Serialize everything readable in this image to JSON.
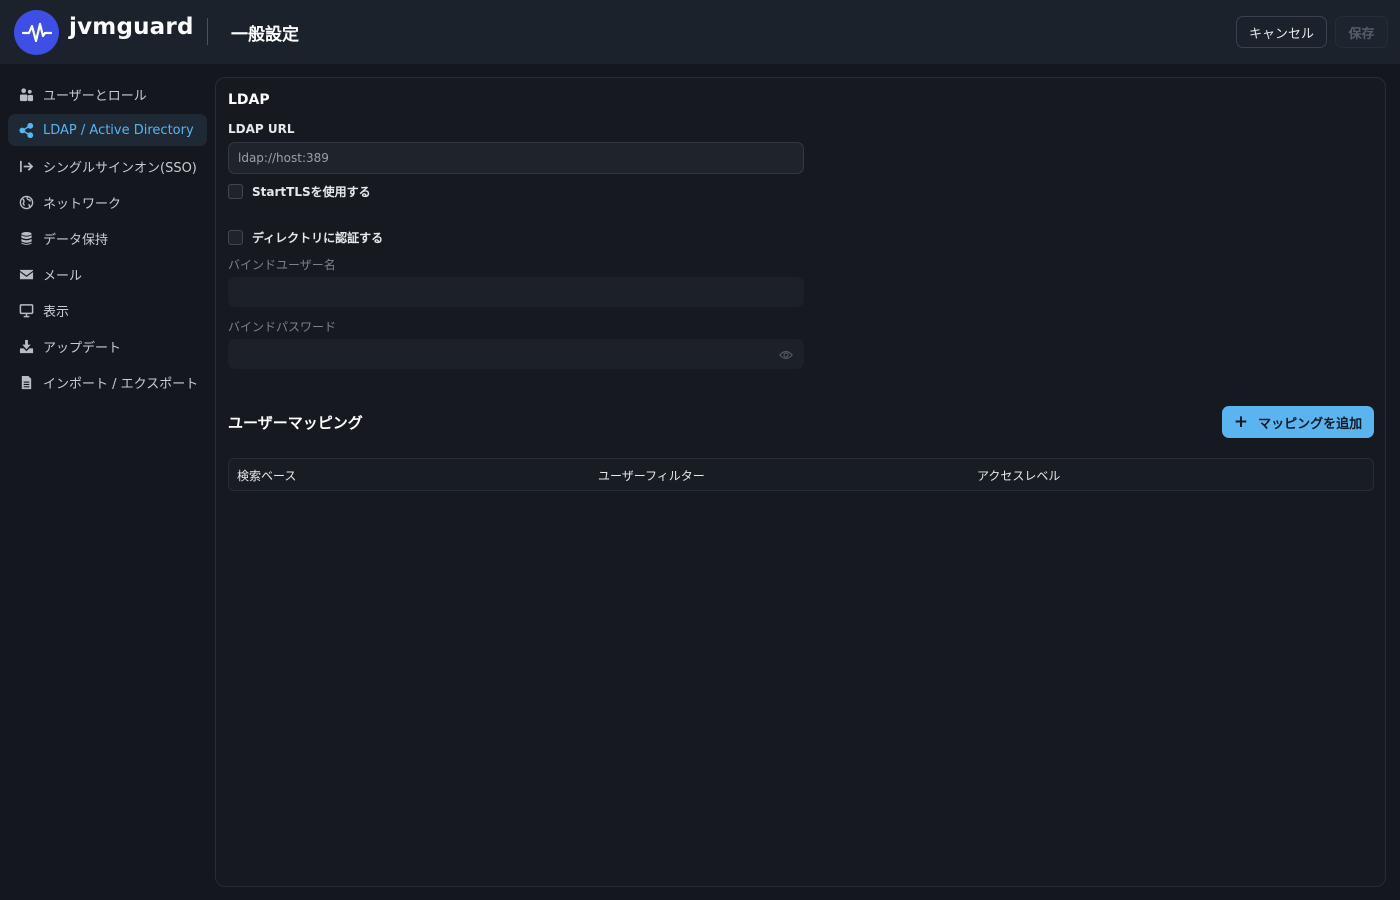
{
  "header": {
    "brand": "jvmguard",
    "title": "一般設定",
    "cancel_label": "キャンセル",
    "save_label": "保存"
  },
  "sidebar": {
    "items": [
      {
        "label": "ユーザーとロール",
        "icon": "users-icon"
      },
      {
        "label": "LDAP / Active Directory",
        "icon": "share-icon",
        "active": true
      },
      {
        "label": "シングルサインオン(SSO)",
        "icon": "sign-in-icon"
      },
      {
        "label": "ネットワーク",
        "icon": "globe-icon"
      },
      {
        "label": "データ保持",
        "icon": "database-icon"
      },
      {
        "label": "メール",
        "icon": "envelope-icon"
      },
      {
        "label": "表示",
        "icon": "monitor-icon"
      },
      {
        "label": "アップデート",
        "icon": "download-icon"
      },
      {
        "label": "インポート / エクスポート",
        "icon": "file-icon"
      }
    ]
  },
  "ldap": {
    "section_title": "LDAP",
    "url_label": "LDAP URL",
    "url_placeholder": "ldap://host:389",
    "starttls_label": "StartTLSを使用する",
    "auth_label": "ディレクトリに認証する",
    "bind_user_label": "バインドユーザー名",
    "bind_password_label": "バインドパスワード"
  },
  "mapping": {
    "title": "ユーザーマッピング",
    "add_label": "マッピングを追加",
    "columns": [
      "検索ベース",
      "ユーザーフィルター",
      "アクセスレベル"
    ]
  },
  "colors": {
    "accent": "#5ab4ef",
    "logo": "#3d4fe6",
    "header_bg": "#1b222c",
    "page_bg": "#14171d"
  }
}
